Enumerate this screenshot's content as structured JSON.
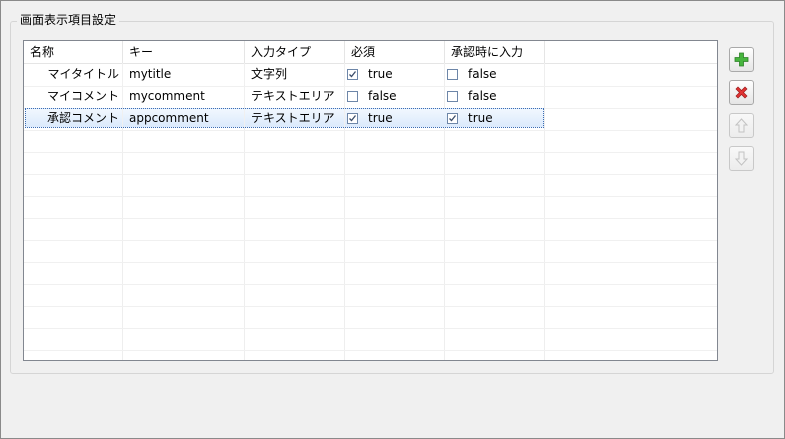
{
  "group": {
    "title": "画面表示項目設定"
  },
  "table": {
    "columns": [
      "名称",
      "キー",
      "入力タイプ",
      "必須",
      "承認時に入力"
    ],
    "rows": [
      {
        "name": "マイタイトル",
        "key": "mytitle",
        "type": "文字列",
        "required": {
          "checked": true,
          "label": "true"
        },
        "on_approval": {
          "checked": false,
          "label": "false"
        },
        "selected": false
      },
      {
        "name": "マイコメント",
        "key": "mycomment",
        "type": "テキストエリア",
        "required": {
          "checked": false,
          "label": "false"
        },
        "on_approval": {
          "checked": false,
          "label": "false"
        },
        "selected": false
      },
      {
        "name": "承認コメント",
        "key": "appcomment",
        "type": "テキストエリア",
        "required": {
          "checked": true,
          "label": "true"
        },
        "on_approval": {
          "checked": true,
          "label": "true"
        },
        "selected": true
      }
    ]
  },
  "buttons": {
    "add": {
      "icon": "plus-icon",
      "enabled": true,
      "color": "#3fa23a"
    },
    "delete": {
      "icon": "x-icon",
      "enabled": true,
      "color": "#d22a2a"
    },
    "move_up": {
      "icon": "arrow-up-icon",
      "enabled": false
    },
    "move_down": {
      "icon": "arrow-down-icon",
      "enabled": false
    }
  }
}
